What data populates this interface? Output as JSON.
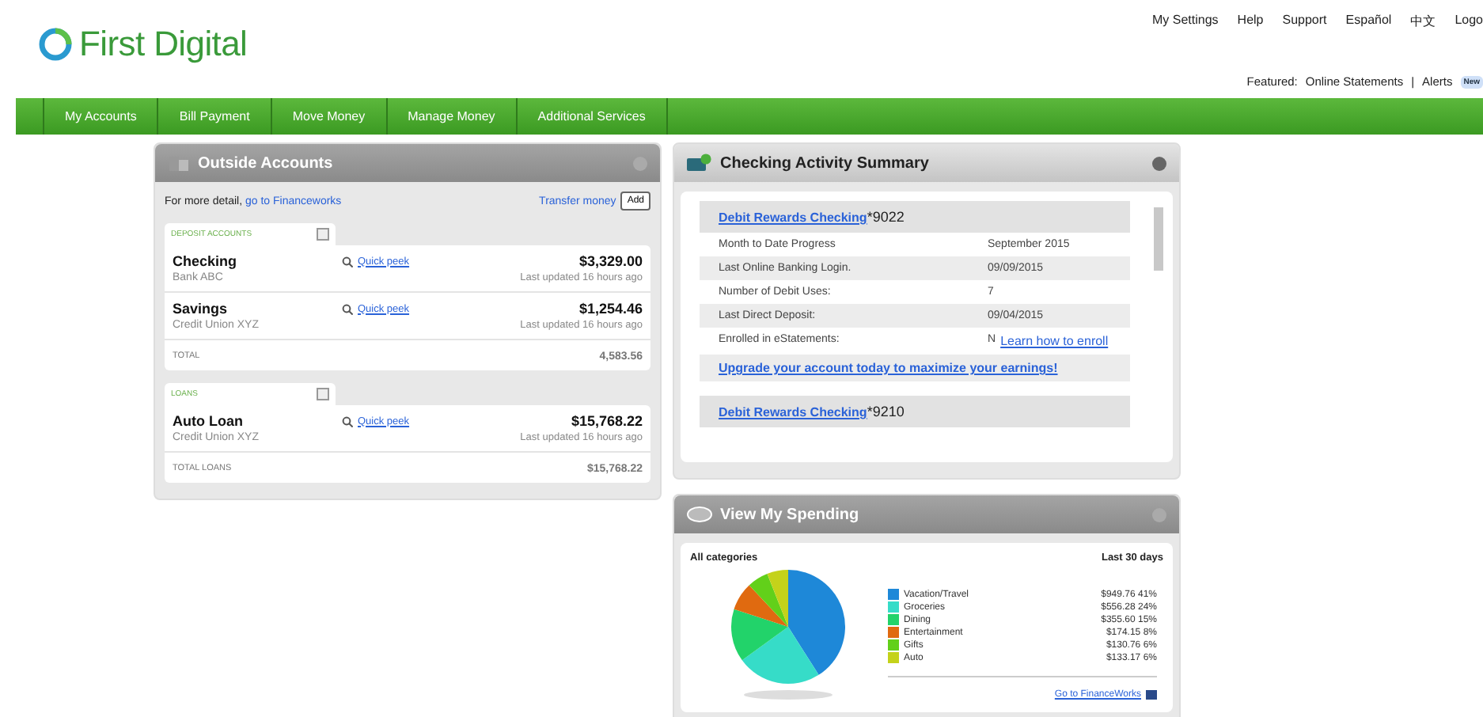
{
  "logo": {
    "text": "First Digital"
  },
  "top_links": [
    "My Settings",
    "Help",
    "Support",
    "Español",
    "中文",
    "Logo"
  ],
  "featured": {
    "label": "Featured:",
    "links": [
      "Online Statements",
      "Alerts"
    ],
    "separator": "|",
    "badge": "New"
  },
  "nav": [
    {
      "label": "My Accounts",
      "selected": false
    },
    {
      "label": "Bill Payment",
      "selected": false
    },
    {
      "label": "Move Money",
      "selected": false
    },
    {
      "label": "Manage Money",
      "selected": false
    },
    {
      "label": "Additional Services",
      "selected": false
    }
  ],
  "outside_accounts": {
    "title": "Outside Accounts",
    "detail_text": "For more detail,",
    "detail_link": "go to Financeworks",
    "transfer_link": "Transfer money",
    "add_button": "Add",
    "sections": [
      {
        "label": "DEPOSIT ACCOUNTS",
        "total_label": "TOTAL",
        "total": "4,583.56",
        "accounts": [
          {
            "name": "Checking",
            "institution": "Bank ABC",
            "quick_peek": "Quick peek",
            "amount": "$3,329.00",
            "updated": "Last updated 16 hours ago"
          },
          {
            "name": "Savings",
            "institution": "Credit Union XYZ",
            "quick_peek": "Quick peek",
            "amount": "$1,254.46",
            "updated": "Last updated 16 hours ago"
          }
        ]
      },
      {
        "label": "LOANS",
        "total_label": "TOTAL LOANS",
        "total": "$15,768.22",
        "accounts": [
          {
            "name": "Auto Loan",
            "institution": "Credit Union XYZ",
            "quick_peek": "Quick peek",
            "amount": "$15,768.22",
            "updated": "Last updated 16 hours ago"
          }
        ]
      }
    ]
  },
  "checking_summary": {
    "title": "Checking Activity Summary",
    "accounts": [
      {
        "link": "Debit Rewards Checking",
        "suffix": "*9022",
        "rows": [
          {
            "label": "Month to Date Progress",
            "value": "September 2015"
          },
          {
            "label": "Last Online Banking Login.",
            "value": "09/09/2015"
          },
          {
            "label": "Number of Debit Uses:",
            "value": "7"
          },
          {
            "label": "Last Direct Deposit:",
            "value": "09/04/2015"
          },
          {
            "label": "Enrolled in eStatements:",
            "value": "N",
            "link": "Learn how to enroll"
          }
        ],
        "upgrade_link": "Upgrade your account today to maximize your earnings!"
      },
      {
        "link": "Debit Rewards Checking",
        "suffix": "*9210"
      }
    ]
  },
  "spending": {
    "title": "View My Spending",
    "filter": "All categories",
    "period": "Last 30 days",
    "link": "Go to FinanceWorks",
    "legend": [
      {
        "amount": "$949.76",
        "percent": "41%",
        "color": "#1e88d8"
      },
      {
        "amount": "$556.28",
        "percent": "24%",
        "color": "#36dcc8"
      },
      {
        "amount": "$355.60",
        "percent": "15%",
        "color": "#22d36a"
      },
      {
        "amount": "$174.15",
        "percent": "8%",
        "color": "#e06a10"
      },
      {
        "amount": "$130.76",
        "percent": "6%",
        "color": "#62d01a"
      },
      {
        "amount": "$133.17",
        "percent": "6%",
        "color": "#c4d21a"
      }
    ],
    "chart_data": {
      "type": "pie",
      "categories": [
        "Vacation/Travel",
        "Groceries",
        "Dining",
        "Entertainment",
        "Gifts",
        "Auto"
      ],
      "values": [
        41,
        24,
        15,
        8,
        6,
        6
      ]
    }
  }
}
